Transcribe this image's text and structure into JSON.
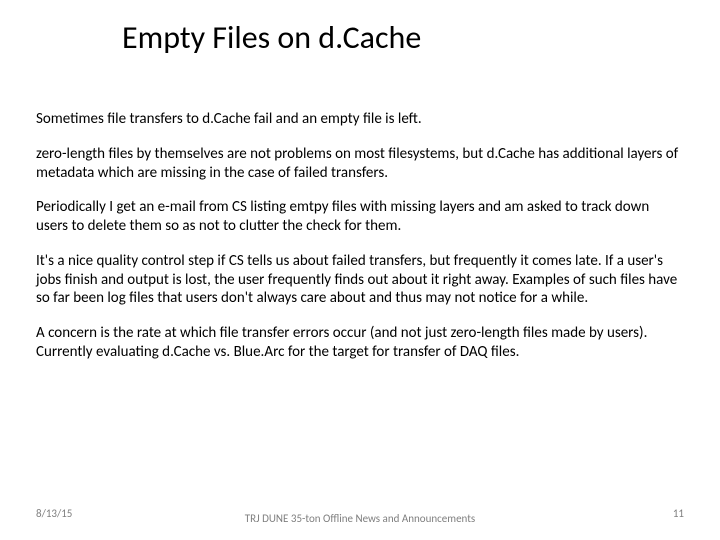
{
  "title": "Empty Files on d.Cache",
  "paragraphs": {
    "p0": "Sometimes file transfers to d.Cache fail and an empty file is left.",
    "p1": "zero-length files by themselves are not problems on most filesystems, but d.Cache has additional layers of metadata which are missing in the case of failed transfers.",
    "p2": "Periodically I get an e-mail from CS listing emtpy files with missing layers and am asked to track down users to delete them so as not to clutter the check for them.",
    "p3": "It's a nice quality control step if CS tells us about failed transfers, but frequently it comes late.  If a user's jobs finish and output is lost, the user frequently finds out about it right away.  Examples of such files have so far been log files that users don't always care about and thus may not notice for a while.",
    "p4": "A concern is the rate at which file transfer errors occur (and not just zero-length files made by users).  Currently evaluating d.Cache vs. Blue.Arc for the target for transfer of DAQ files."
  },
  "footer": {
    "date": "8/13/15",
    "center": "TRJ DUNE 35-ton Offline News and Announcements",
    "page": "11"
  }
}
